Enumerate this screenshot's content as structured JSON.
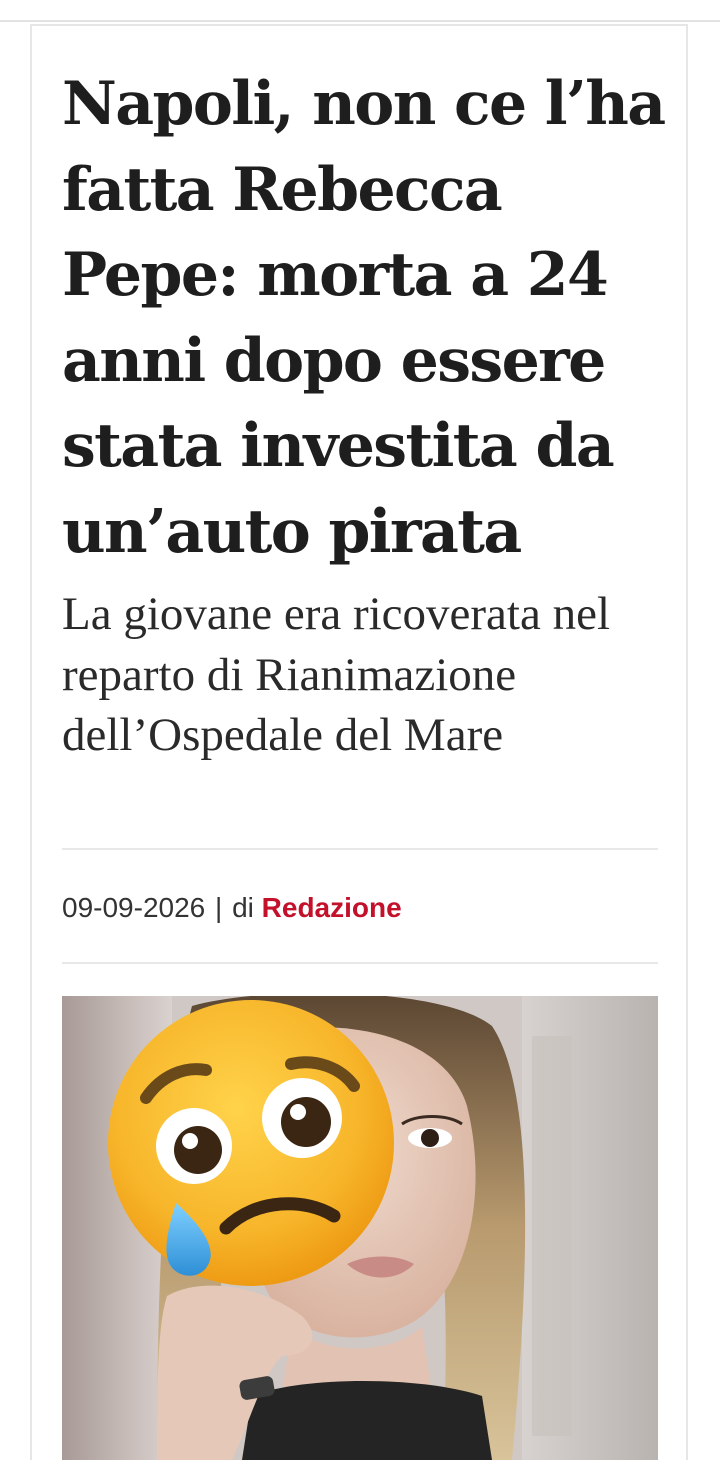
{
  "article": {
    "headline": "Napoli, non ce l’ha fatta Rebecca Pepe: morta a 24 anni dopo essere stata investita da un’auto pirata",
    "subtitle": "La giovane era ricoverata nel reparto di Rianimazione dell’Ospedale del Mare",
    "date": "09-09-2026",
    "separator": "|",
    "by_prefix": "di",
    "author": "Redazione"
  },
  "photo": {
    "overlay_icon": "crying-face-emoji-icon"
  },
  "colors": {
    "author_accent": "#c3112b",
    "headline": "#1e1e1e",
    "subtitle": "#2a2a2a",
    "divider": "#e8e8e8",
    "emoji_yellow": "#f6b21e",
    "emoji_tear": "#45a9e6"
  }
}
